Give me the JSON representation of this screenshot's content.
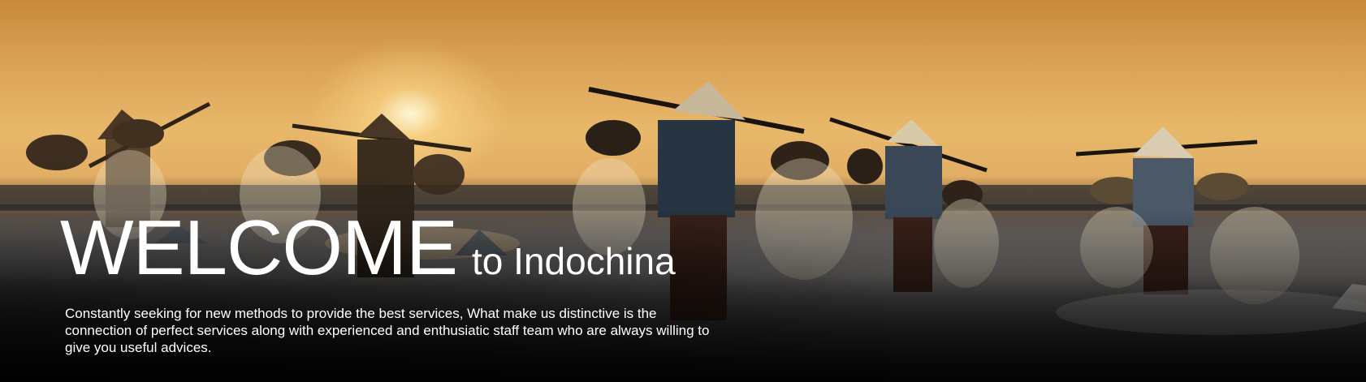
{
  "hero": {
    "title": "WELCOME",
    "subtitle": "to Indochina",
    "description": "Constantly seeking for new methods to provide the best services, What make us distinctive is the connection of perfect services along with experienced and enthusiatic staff team who are always willing to give you useful advices."
  },
  "colors": {
    "sky": "#dca458",
    "sun": "#fff6d8",
    "water": "#7d7b79",
    "text": "#ffffff"
  }
}
